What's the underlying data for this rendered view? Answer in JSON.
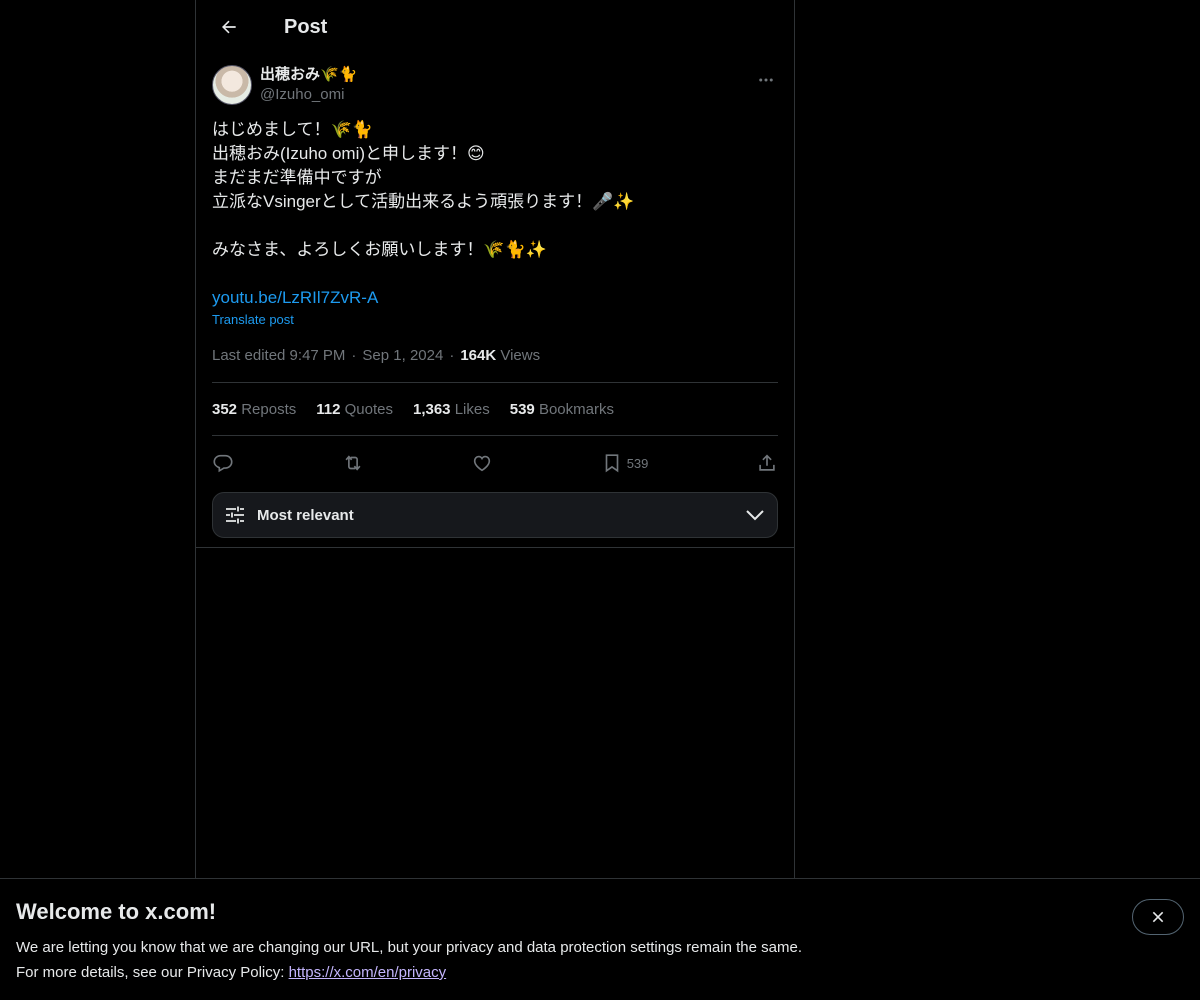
{
  "header": {
    "title": "Post"
  },
  "author": {
    "display_name": "出穂おみ🌾🐈",
    "handle": "@Izuho_omi"
  },
  "post": {
    "lines": [
      "はじめまして！🌾🐈",
      "出穂おみ(Izuho omi)と申します！😊",
      "まだまだ準備中ですが",
      "立派なVsingerとして活動出来るよう頑張ります！🎤✨",
      "",
      "みなさま、よろしくお願いします！🌾🐈✨"
    ],
    "link": "youtu.be/LzRIl7ZvR-A",
    "translate": "Translate post",
    "edited_label": "Last edited 9:47 PM",
    "date": "Sep 1, 2024",
    "views_count": "164K",
    "views_label": "Views"
  },
  "stats": {
    "reposts_count": "352",
    "reposts_label": "Reposts",
    "quotes_count": "112",
    "quotes_label": "Quotes",
    "likes_count": "1,363",
    "likes_label": "Likes",
    "bookmarks_count": "539",
    "bookmarks_label": "Bookmarks"
  },
  "actions": {
    "bookmark_count": "539"
  },
  "sort": {
    "label": "Most relevant"
  },
  "banner": {
    "title": "Welcome to x.com!",
    "line1": "We are letting you know that we are changing our URL, but your privacy and data protection settings remain the same.",
    "line2_prefix": "For more details, see our Privacy Policy: ",
    "link": "https://x.com/en/privacy"
  },
  "colors": {
    "background": "#000000",
    "accent": "#1d9bf0",
    "muted": "#71767b",
    "border": "#2f3336"
  }
}
